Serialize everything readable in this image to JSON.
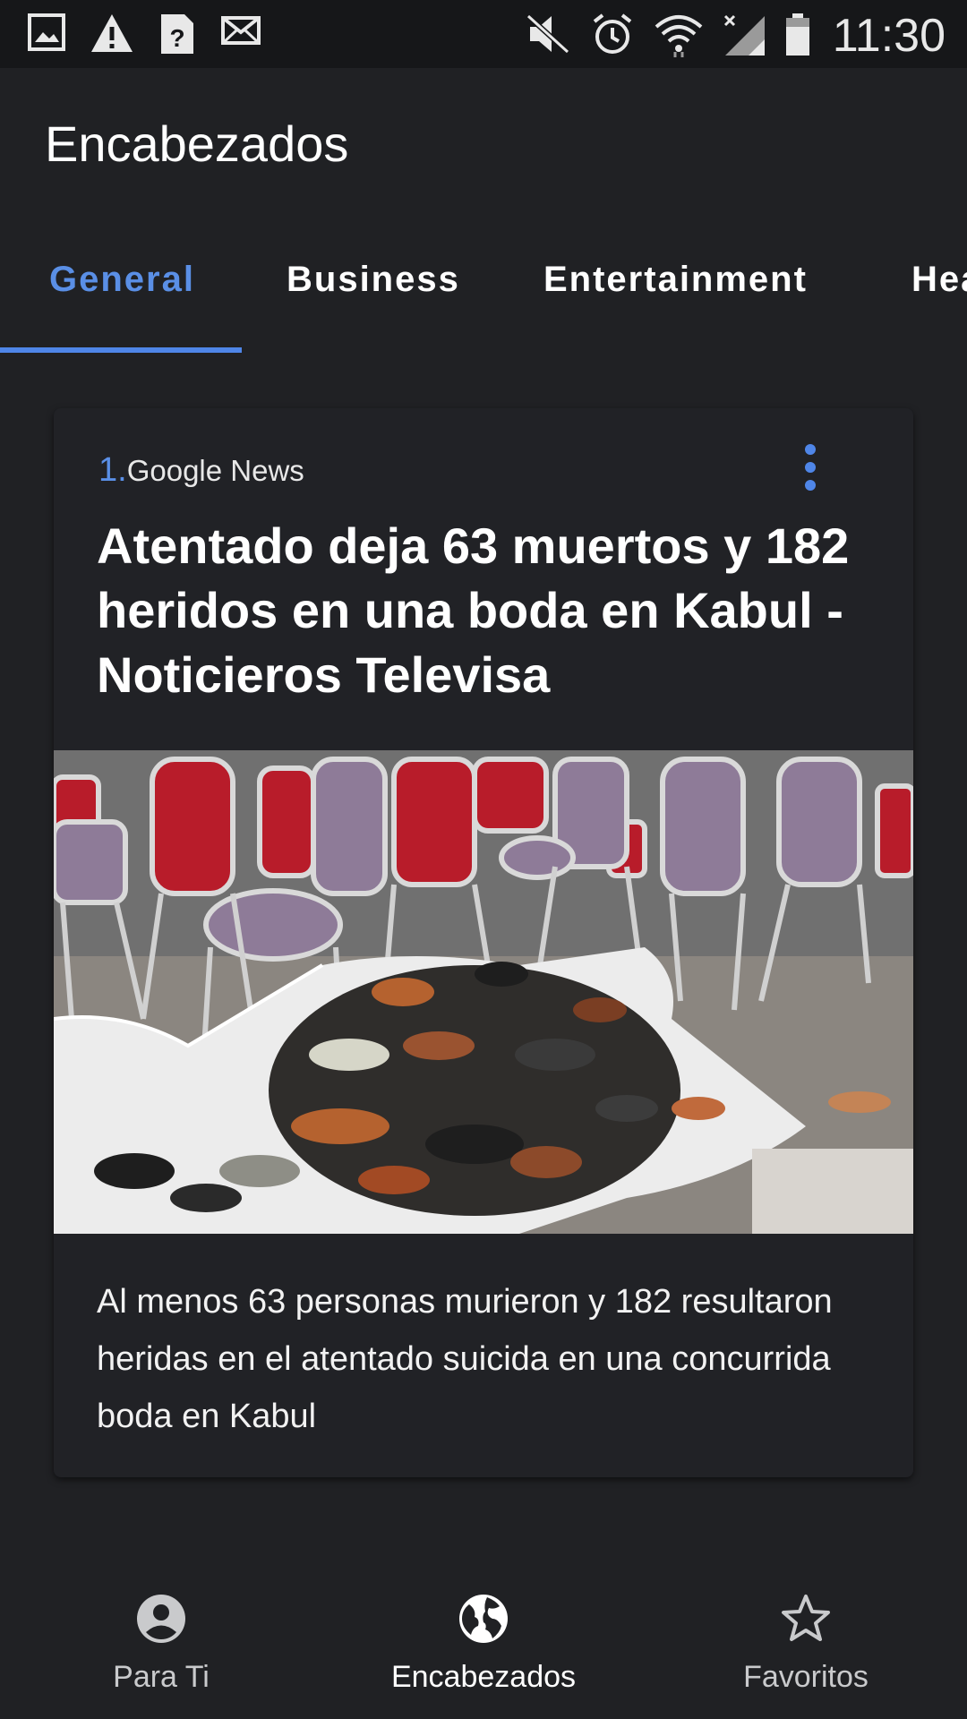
{
  "status_bar": {
    "time": "11:30",
    "icons": [
      "image-notification-icon",
      "warning-icon",
      "unknown-file-icon",
      "mail-icon",
      "mute-icon",
      "alarm-icon",
      "wifi-icon",
      "signal-icon",
      "battery-icon"
    ]
  },
  "app_bar": {
    "title": "Encabezados"
  },
  "tabs": [
    {
      "label": "General",
      "active": true
    },
    {
      "label": "Business",
      "active": false
    },
    {
      "label": "Entertainment",
      "active": false
    },
    {
      "label": "Health",
      "active": false
    }
  ],
  "article": {
    "rank": "1.",
    "source": "Google News",
    "title": "Atentado deja 63 muertos y 182 heridos en una boda en Kabul - Noticieros Televisa",
    "description": "Al menos 63 personas murieron y 182 resultaron heridas en el atentado suicida en una concurrida boda en Kabul",
    "image_alt": "chairs and pile of shoes on white cloth",
    "menu_icon": "more-vert-icon"
  },
  "bottom_nav": [
    {
      "label": "Para Ti",
      "icon": "person-icon",
      "active": false
    },
    {
      "label": "Encabezados",
      "icon": "globe-icon",
      "active": true
    },
    {
      "label": "Favoritos",
      "icon": "star-icon",
      "active": false
    }
  ],
  "colors": {
    "background": "#202124",
    "accent": "#4f86e8",
    "text": "#ffffff"
  }
}
